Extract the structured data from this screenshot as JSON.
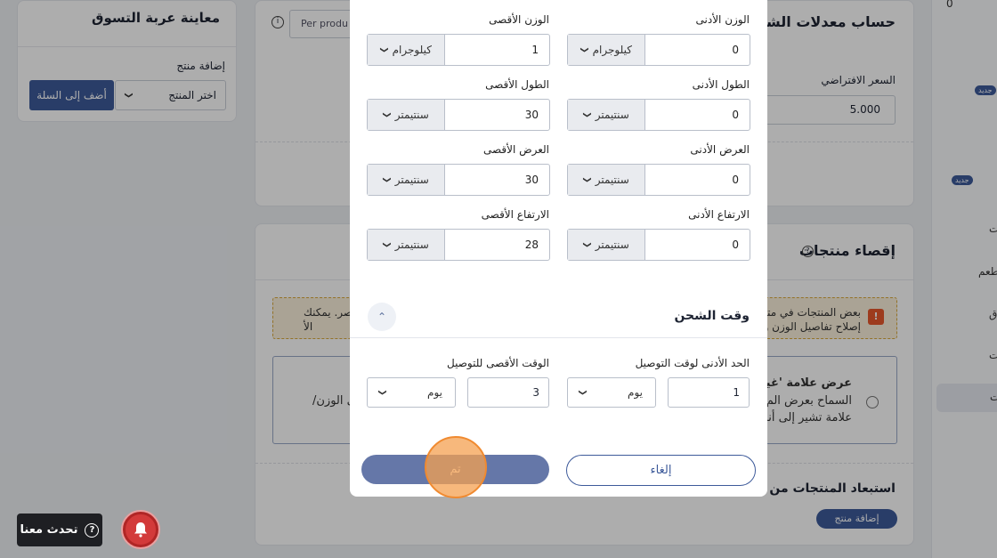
{
  "cart_preview": {
    "title": "معاينة عربة التسوق",
    "add_product_label": "إضافة منتج",
    "select_placeholder": "اختر المنتج",
    "add_to_cart": "أضف إلى السلة"
  },
  "shipping_rates": {
    "title": "حساب معدلات الشحن",
    "per_product": "Per produ",
    "default_price_label": "السعر الافتراضي",
    "default_price_value": "5.000"
  },
  "exclude": {
    "title": "إقصاء منتجات",
    "warning_line1": "بعض المنتجات في متجر",
    "warning_line2": "إصلاح تفاصيل الوزن والأ",
    "warning_tail1": "اصر. يمكنك",
    "warning_tail2": "الأ",
    "option_title": "عرض علامة 'غير",
    "option_line2": "السماح بعرض الم",
    "option_line3": "علامة تشير إلى أنه",
    "option_tail": "لى الوزن/",
    "exclude_products_title": "استبعاد المنتجات من الش",
    "add_product_button": "إضافة منتج"
  },
  "right_strip": {
    "top_value": "0",
    "new_badge": "جديد",
    "item_a": "ت",
    "item_b": "طعم",
    "item_c": "ق",
    "item_d": "ت",
    "item_e": "ت"
  },
  "modal": {
    "weight": {
      "min_label": "الوزن الأدنى",
      "min_value": "0",
      "min_unit": "كيلوجرام",
      "max_label": "الوزن الأقصى",
      "max_value": "1",
      "max_unit": "كيلوجرام"
    },
    "length": {
      "min_label": "الطول الأدنى",
      "min_value": "0",
      "min_unit": "سنتيمتر",
      "max_label": "الطول الأقصى",
      "max_value": "30",
      "max_unit": "سنتيمتر"
    },
    "width": {
      "min_label": "العرض الأدنى",
      "min_value": "0",
      "min_unit": "سنتيمتر",
      "max_label": "العرض الأقصى",
      "max_value": "30",
      "max_unit": "سنتيمتر"
    },
    "height": {
      "min_label": "الارتفاع الأدنى",
      "min_value": "0",
      "min_unit": "سنتيمتر",
      "max_label": "الارتفاع الأقصى",
      "max_value": "28",
      "max_unit": "سنتيمتر"
    },
    "shipping_time": {
      "title": "وقت الشحن",
      "min_label": "الحد الأدنى لوقت التوصيل",
      "min_value": "1",
      "min_unit": "يوم",
      "max_label": "الوقت الأقصى للتوصيل",
      "max_value": "3",
      "max_unit": "يوم"
    },
    "done_button": "تم",
    "cancel_button": "إلغاء"
  },
  "chat": {
    "label": "تحدث معنا"
  },
  "icons": {
    "chevron": "chevron-down-icon",
    "collapse": "chevron-up-icon",
    "help": "question-circle-icon",
    "bell": "bell-icon",
    "warning": "warning-icon"
  },
  "colors": {
    "primary": "#3d5a9a",
    "done_button": "#6577a8",
    "warning_bg": "#fbf1dc",
    "warning_icon": "#e8572b",
    "notification": "#d33a3a",
    "click_indicator": "#f08a30"
  }
}
